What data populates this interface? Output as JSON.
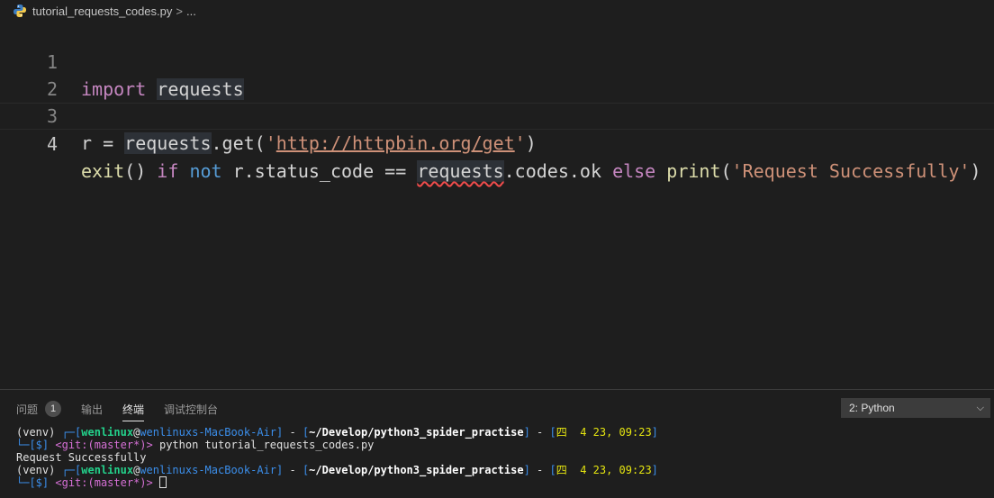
{
  "breadcrumb": {
    "filename": "tutorial_requests_codes.py",
    "separator": ">",
    "more": "..."
  },
  "editor": {
    "lines": [
      {
        "number": "1"
      },
      {
        "number": "2"
      },
      {
        "number": "3"
      },
      {
        "number": "4"
      }
    ],
    "line1": {
      "kw": "import",
      "sp": " ",
      "mod": "requests"
    },
    "line3": {
      "a": "r = ",
      "mod": "requests",
      "b": ".get(",
      "q1": "'",
      "url": "http://httpbin.org/get",
      "q2": "'",
      "c": ")"
    },
    "line4": {
      "exit": "exit",
      "p1": "() ",
      "if": "if",
      "sp1": " ",
      "not": "not",
      "a": " r.status_code == ",
      "mod": "requests",
      "b": ".codes.ok ",
      "else": "else",
      "sp2": " ",
      "print": "print",
      "p2": "(",
      "str": "'Request Successfully'",
      "p3": ")"
    }
  },
  "panel": {
    "tabs": {
      "problems": "问题",
      "problems_count": "1",
      "output": "输出",
      "terminal": "终端",
      "debug_console": "调试控制台"
    },
    "terminal_selector": "2: Python",
    "terminal": {
      "prompt": {
        "venv": "(venv) ",
        "corner_top": "┌─",
        "user": "wenlinux",
        "at": "@",
        "host": "wenlinuxs-MacBook-Air",
        "dash": " - ",
        "path": "~/Develop/python3_spider_practise",
        "date": "四  4 23, 09:23",
        "corner_bottom": "└─",
        "dollar": "[$]",
        "git": "<git:(master*)>"
      },
      "command": " python tutorial_requests_codes.py",
      "output": "Request Successfully"
    }
  }
}
